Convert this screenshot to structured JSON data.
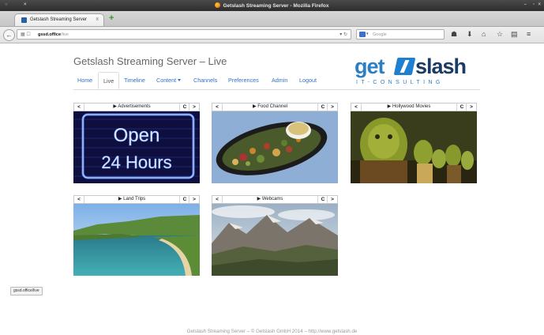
{
  "window": {
    "title": "Getslash Streaming Server - Mozilla Firefox"
  },
  "tab": {
    "label": "Getslash Streaming Server",
    "close": "x",
    "new_tab": "+"
  },
  "urlbar": {
    "host": "gssd.office",
    "path": "/live"
  },
  "searchbar": {
    "placeholder": "Google"
  },
  "site": {
    "title": "Getslash Streaming Server – Live",
    "logo": {
      "get": "get",
      "slash": "slash",
      "sub": "IT-CONSULTING"
    },
    "nav": [
      {
        "label": "Home"
      },
      {
        "label": "Live",
        "active": true
      },
      {
        "label": "Timeline"
      },
      {
        "label": "Content",
        "dropdown": true
      },
      {
        "label": "Channels"
      },
      {
        "label": "Preferences"
      },
      {
        "label": "Admin"
      },
      {
        "label": "Logout"
      }
    ]
  },
  "channels": [
    {
      "name": "Advertisements",
      "image": "neon-sign",
      "sign_line1": "Open",
      "sign_line2": "24 Hours"
    },
    {
      "name": "Food Channel",
      "image": "food-platter"
    },
    {
      "name": "Hollywood Movies",
      "image": "animated-ogres"
    },
    {
      "name": "Land Trips",
      "image": "coastal-bay"
    },
    {
      "name": "Webcams",
      "image": "mountain-range"
    }
  ],
  "controls": {
    "prev": "<",
    "next": ">",
    "reload": "C",
    "play": "▶"
  },
  "footer": {
    "text": "Getslash Streaming Server – © Getslash GmbH 2014 – http://www.getslash.de"
  },
  "statusbar": {
    "text": "gssd.office/live"
  }
}
